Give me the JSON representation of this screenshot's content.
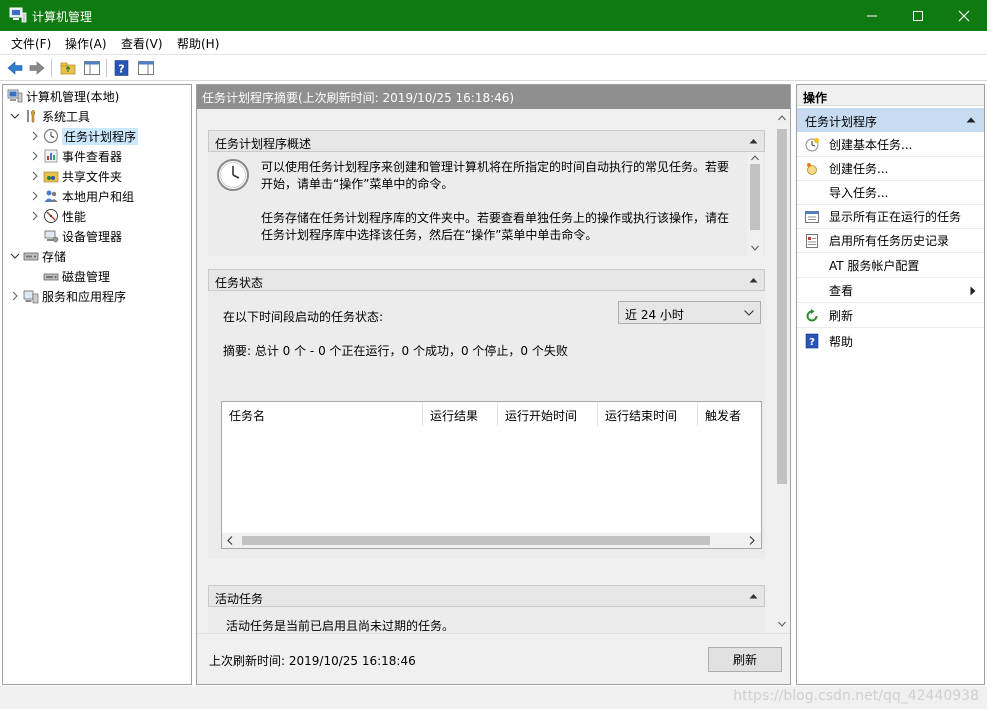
{
  "window": {
    "title": "计算机管理",
    "brand_color": "#0f7a0f"
  },
  "menu": [
    "文件(F)",
    "操作(A)",
    "查看(V)",
    "帮助(H)"
  ],
  "tree": {
    "root": "计算机管理(本地)",
    "system_tools": "系统工具",
    "task_scheduler": "任务计划程序",
    "event_viewer": "事件查看器",
    "shared_folders": "共享文件夹",
    "local_users": "本地用户和组",
    "performance": "性能",
    "device_manager": "设备管理器",
    "storage": "存储",
    "disk_management": "磁盘管理",
    "services_apps": "服务和应用程序"
  },
  "center": {
    "header": "任务计划程序摘要(上次刷新时间: 2019/10/25 16:18:46)",
    "overview": {
      "title": "任务计划程序概述",
      "line1": "可以使用任务计划程序来创建和管理计算机将在所指定的时间自动执行的常见任务。若要",
      "line2": "开始，请单击“操作”菜单中的命令。",
      "line3": "任务存储在任务计划程序库的文件夹中。若要查看单独任务上的操作或执行该操作，请在",
      "line4": "任务计划程序库中选择该任务，然后在“操作”菜单中单击命令。"
    },
    "status": {
      "title": "任务状态",
      "period_label": "在以下时间段启动的任务状态:",
      "period_value": "近 24 小时",
      "summary": "摘要: 总计 0 个 - 0 个正在运行，0 个成功，0 个停止，0 个失败",
      "columns": [
        "任务名",
        "运行结果",
        "运行开始时间",
        "运行结束时间",
        "触发者"
      ]
    },
    "active": {
      "title": "活动任务",
      "partial": "活动任务是当前已启用且尚未过期的任务。"
    },
    "footer": {
      "last_refresh": "上次刷新时间: 2019/10/25 16:18:46",
      "refresh_button": "刷新"
    }
  },
  "actions": {
    "header": "操作",
    "subheader": "任务计划程序",
    "items": [
      "创建基本任务...",
      "创建任务...",
      "导入任务...",
      "显示所有正在运行的任务",
      "启用所有任务历史记录",
      "AT 服务帐户配置",
      "查看",
      "刷新",
      "帮助"
    ]
  },
  "watermark": "https://blog.csdn.net/qq_42440938"
}
